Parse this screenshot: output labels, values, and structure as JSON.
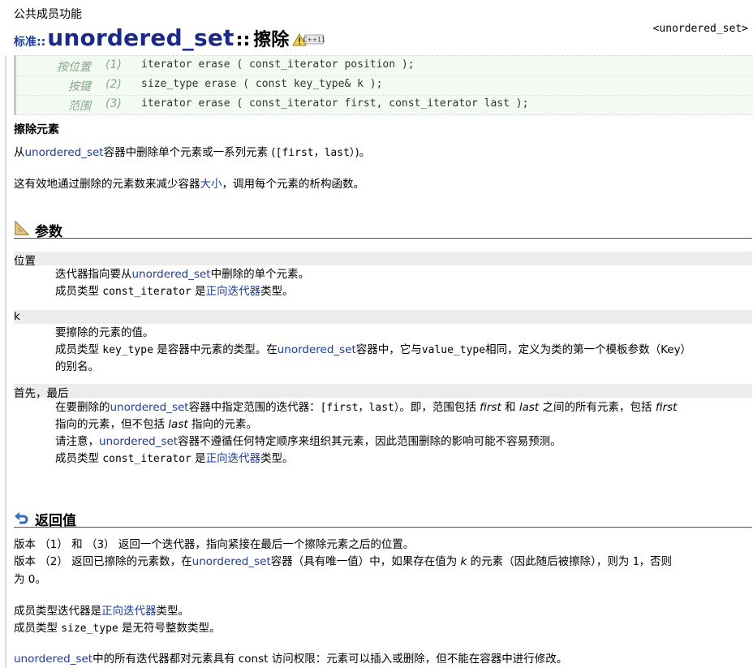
{
  "kicker": "公共成员功能",
  "title": {
    "namespace": "标准:",
    "sep": ":",
    "class_name": "unordered_set",
    "scope": "::",
    "function": "擦除",
    "badge": "C++11"
  },
  "header_ref": "<unordered_set>",
  "prototypes": [
    {
      "label": "按位置",
      "num": "(1)",
      "code": "iterator erase ( const_iterator position );"
    },
    {
      "label": "按键",
      "num": "(2)",
      "code": "size_type erase ( const key_type& k );"
    },
    {
      "label": "范围",
      "num": "(3)",
      "code": "iterator erase ( const_iterator first, const_iterator last );"
    }
  ],
  "summary_title": "擦除元素",
  "summary": {
    "p1_a": "从",
    "p1_link": "unordered_set",
    "p1_b": "容器中删除单个元素或一系列元素 (",
    "p1_code": "[first，last）",
    "p1_c": ")。",
    "p2_a": "这有效地通过删除的元素数来减少容器",
    "p2_link": "大小",
    "p2_b": "，调用每个元素的析构函数。"
  },
  "params": {
    "title": "参数",
    "position": {
      "name": "位置",
      "l1_a": "迭代器指向要从",
      "l1_link": "unordered_set",
      "l1_b": "中删除的单个元素。",
      "l2_a": "成员类型 ",
      "l2_code": "const_iterator",
      "l2_b": " 是",
      "l2_link": "正向迭代器",
      "l2_c": "类型。"
    },
    "k": {
      "name": "k",
      "l1": "要擦除的元素的值。",
      "l2_a": "成员类型 ",
      "l2_code": "key_type",
      "l2_b": " 是容器中元素的类型。在",
      "l2_link": "unordered_set",
      "l2_c": "容器中，它与",
      "l2_code2": "value_type",
      "l2_d": "相同，定义为类的第一个模板参数（Key）",
      "l3": "的别名。"
    },
    "range": {
      "name": "首先，最后",
      "l1_a": "在要删除的",
      "l1_link": "unordered_set",
      "l1_b": "容器中指定范围的迭代器：",
      "l1_code": "[first，last）",
      "l1_c": "。即，范围包括 ",
      "l1_i1": "first",
      "l1_d": " 和 ",
      "l1_i2": "last",
      "l1_e": " 之间的所有元素，包括 ",
      "l1_i3": "first",
      "l2_a": "指向的元素，但不包括 ",
      "l2_i": "last",
      "l2_b": " 指向的元素。",
      "l3_a": "请注意，",
      "l3_link": "unordered_set",
      "l3_b": "容器不遵循任何特定顺序来组织其元素，因此范围删除的影响可能不容易预测。",
      "l4_a": "成员类型 ",
      "l4_code": "const_iterator",
      "l4_b": " 是",
      "l4_link": "正向迭代器",
      "l4_c": "类型。"
    }
  },
  "returns": {
    "title": "返回值",
    "r1": "版本 （1） 和 （3） 返回一个迭代器，指向紧接在最后一个擦除元素之后的位置。",
    "r2_a": "版本 （2） 返回已擦除的元素数，在",
    "r2_link": "unordered_set",
    "r2_b": "容器（具有唯一值）中，如果存在值为 ",
    "r2_i": "k",
    "r2_c": " 的元素（因此随后被擦除），则为 ",
    "r2_code": "1",
    "r2_d": "，否则",
    "r3": "为 0。",
    "m1_a": "成员类型迭代器是",
    "m1_link": "正向迭代器",
    "m1_b": "类型。",
    "m2_a": "成员类型 ",
    "m2_code": "size_type",
    "m2_b": " 是无符号整数类型。",
    "last_link": "unordered_set",
    "last_a": "中的所有迭代器都对元素具有 const 访问权限：元素可以插入或删除，但不能在容器中进行修改。"
  }
}
